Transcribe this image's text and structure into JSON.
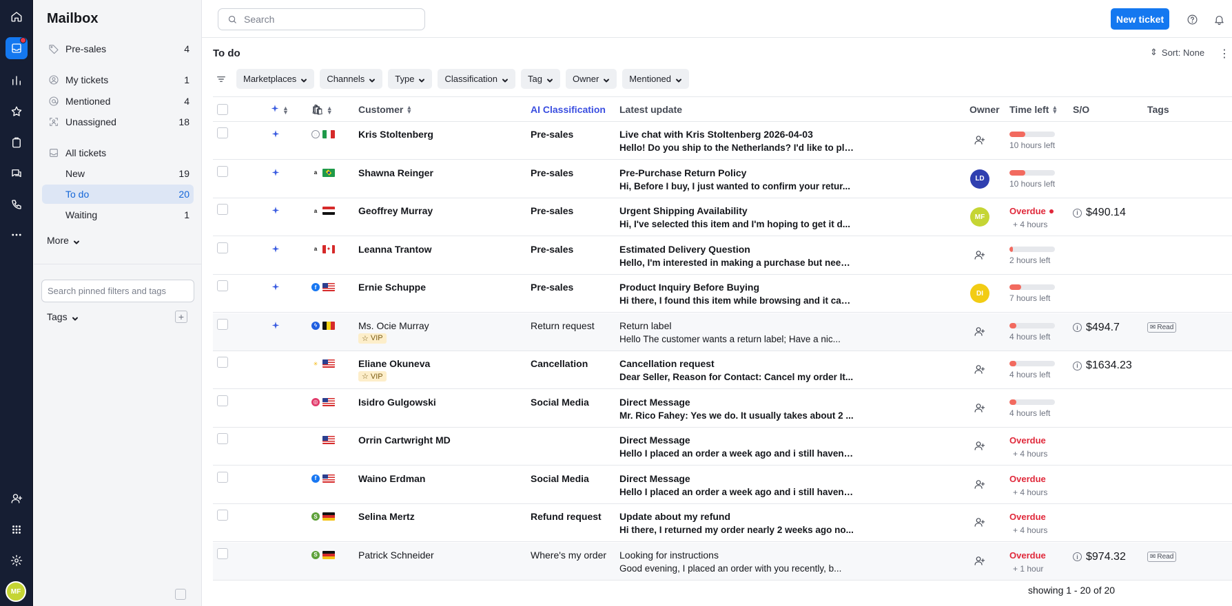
{
  "rail": {
    "avatar": "MF",
    "colors": {
      "bg": "#161e33",
      "active": "#1478f0",
      "badge": "#e8394a"
    }
  },
  "sidebar": {
    "title": "Mailbox",
    "items": [
      {
        "label": "Pre-sales",
        "count": "4",
        "icon": "tag-icon"
      },
      {
        "label": "My tickets",
        "count": "1",
        "icon": "user-circle-icon"
      },
      {
        "label": "Mentioned",
        "count": "4",
        "icon": "at-icon"
      },
      {
        "label": "Unassigned",
        "count": "18",
        "icon": "unassigned-icon"
      },
      {
        "label": "All tickets",
        "count": "",
        "icon": "inbox-stack-icon"
      },
      {
        "label": "New",
        "count": "19"
      },
      {
        "label": "To do",
        "count": "20"
      },
      {
        "label": "Waiting",
        "count": "1"
      }
    ],
    "more_label": "More",
    "pin_search_placeholder": "Search pinned filters and tags",
    "tags_label": "Tags"
  },
  "topbar": {
    "search_placeholder": "Search",
    "new_ticket_label": "New ticket"
  },
  "view": {
    "title": "To do",
    "sort_label": "Sort: None",
    "filters": [
      "Marketplaces",
      "Channels",
      "Type",
      "Classification",
      "Tag",
      "Owner",
      "Mentioned"
    ]
  },
  "table": {
    "headers": {
      "customer": "Customer",
      "ai_classification": "AI Classification",
      "latest_update": "Latest update",
      "owner": "Owner",
      "time_left": "Time left",
      "so": "S/O",
      "tags": "Tags"
    },
    "rows": [
      {
        "ai": true,
        "source": "web",
        "flag": "IT",
        "customer": "Kris Stoltenberg",
        "vip": "",
        "classification": "Pre-sales",
        "subject": "Live chat with Kris Stoltenberg 2026-04-03",
        "preview": "Hello! Do you ship to the Netherlands? I'd like to pla...",
        "owner": "",
        "owner_color": "",
        "time_fill": 0.35,
        "time_text": "10 hours left",
        "overdue": "",
        "plus": "",
        "so": "",
        "tag": "",
        "unread": true
      },
      {
        "ai": true,
        "source": "amazon",
        "flag": "BR",
        "customer": "Shawna Reinger",
        "vip": "",
        "classification": "Pre-sales",
        "subject": "Pre-Purchase Return Policy",
        "preview": "Hi, Before I buy, I just wanted to confirm your retur...",
        "owner": "LD",
        "owner_color": "#2f3fb0",
        "time_fill": 0.35,
        "time_text": "10 hours left",
        "overdue": "",
        "plus": "",
        "so": "",
        "tag": "",
        "unread": true
      },
      {
        "ai": true,
        "source": "amazon",
        "flag": "EG",
        "customer": "Geoffrey Murray",
        "vip": "",
        "classification": "Pre-sales",
        "subject": "Urgent Shipping Availability",
        "preview": "Hi, I've selected this item and I'm hoping to get it d...",
        "owner": "MF",
        "owner_color": "#c5d534",
        "time_fill": 0,
        "time_text": "",
        "overdue": "Overdue",
        "plus": "+ 4 hours",
        "so": "$490.14",
        "tag": "",
        "unread": true
      },
      {
        "ai": true,
        "source": "amazon",
        "flag": "CA",
        "customer": "Leanna Trantow",
        "vip": "",
        "classification": "Pre-sales",
        "subject": "Estimated Delivery Question",
        "preview": "Hello, I'm interested in making a purchase but need...",
        "owner": "",
        "owner_color": "",
        "time_fill": 0.05,
        "time_text": "2 hours left",
        "overdue": "",
        "plus": "",
        "so": "",
        "tag": "",
        "unread": true
      },
      {
        "ai": true,
        "source": "facebook",
        "flag": "US",
        "customer": "Ernie Schuppe",
        "vip": "",
        "classification": "Pre-sales",
        "subject": "Product Inquiry Before Buying",
        "preview": "Hi there, I found this item while browsing and it cau...",
        "owner": "DI",
        "owner_color": "#f2cc14",
        "time_fill": 0.25,
        "time_text": "7 hours left",
        "overdue": "",
        "plus": "",
        "so": "",
        "tag": "",
        "unread": true
      },
      {
        "ai": true,
        "source": "messenger",
        "flag": "BE",
        "customer": "Ms. Ocie Murray",
        "vip": "VIP",
        "classification": "Return request",
        "subject": "Return label",
        "preview": "Hello The customer wants a return label; Have a nic...",
        "owner": "",
        "owner_color": "",
        "time_fill": 0.15,
        "time_text": "4 hours left",
        "overdue": "",
        "plus": "",
        "so": "$494.7",
        "tag": "Read",
        "unread": false
      },
      {
        "ai": false,
        "source": "walmart",
        "flag": "US",
        "customer": "Eliane Okuneva",
        "vip": "VIP",
        "classification": "Cancellation",
        "subject": "Cancellation request",
        "preview": "Dear Seller, Reason for Contact: Cancel my order It...",
        "owner": "",
        "owner_color": "",
        "time_fill": 0.15,
        "time_text": "4 hours left",
        "overdue": "",
        "plus": "",
        "so": "$1634.23",
        "tag": "",
        "unread": true
      },
      {
        "ai": false,
        "source": "instagram",
        "flag": "US",
        "customer": "Isidro Gulgowski",
        "vip": "",
        "classification": "Social Media",
        "subject": "Direct Message",
        "preview": "Mr. Rico Fahey: Yes we do. It usually takes about 2 ...",
        "owner": "",
        "owner_color": "",
        "time_fill": 0.15,
        "time_text": "4 hours left",
        "overdue": "",
        "plus": "",
        "so": "",
        "tag": "",
        "unread": true
      },
      {
        "ai": false,
        "source": "",
        "flag": "US",
        "customer": "Orrin Cartwright MD",
        "vip": "",
        "classification": "",
        "subject": "Direct Message",
        "preview": "Hello I placed an order a week ago and i still haven'...",
        "owner": "",
        "owner_color": "",
        "time_fill": 0,
        "time_text": "",
        "overdue": "Overdue",
        "plus": "+ 4 hours",
        "so": "",
        "tag": "",
        "unread": true
      },
      {
        "ai": false,
        "source": "facebook",
        "flag": "US",
        "customer": "Waino Erdman",
        "vip": "",
        "classification": "Social Media",
        "subject": "Direct Message",
        "preview": "Hello I placed an order a week ago and i still haven'...",
        "owner": "",
        "owner_color": "",
        "time_fill": 0,
        "time_text": "",
        "overdue": "Overdue",
        "plus": "+ 4 hours",
        "so": "",
        "tag": "",
        "unread": true
      },
      {
        "ai": false,
        "source": "shopify",
        "flag": "DE",
        "customer": "Selina Mertz",
        "vip": "",
        "classification": "Refund request",
        "subject": "Update about my refund",
        "preview": "Hi there, I returned my order nearly 2 weeks ago no...",
        "owner": "",
        "owner_color": "",
        "time_fill": 0,
        "time_text": "",
        "overdue": "Overdue",
        "plus": "+ 4 hours",
        "so": "",
        "tag": "",
        "unread": true
      },
      {
        "ai": false,
        "source": "shopify",
        "flag": "DE",
        "customer": "Patrick Schneider",
        "vip": "",
        "classification": "Where's my order",
        "subject": "Looking for instructions",
        "preview": "Good evening, I placed an order with you recently, b...",
        "owner": "",
        "owner_color": "",
        "time_fill": 0,
        "time_text": "",
        "overdue": "Overdue",
        "plus": "+ 1 hour",
        "so": "$974.32",
        "tag": "Read",
        "unread": false
      }
    ]
  },
  "footer": {
    "showing": "showing 1 - 20 of 20"
  }
}
